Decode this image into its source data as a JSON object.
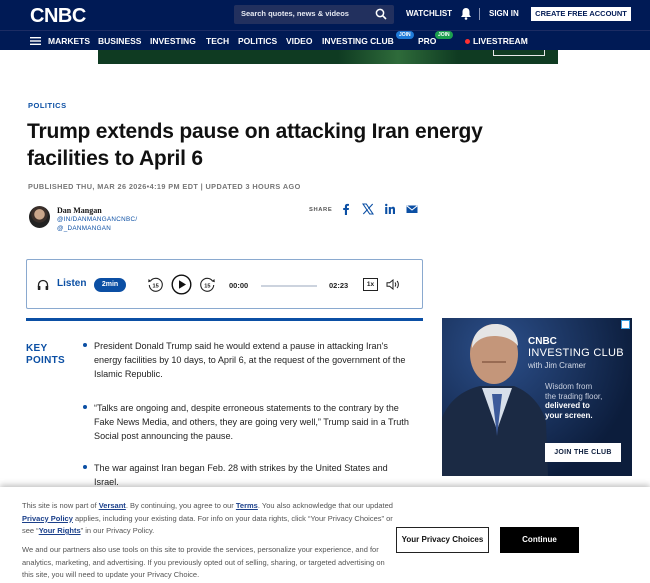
{
  "header": {
    "logo": "CNBC",
    "search_placeholder": "Search quotes, news & videos",
    "watchlist": "WATCHLIST",
    "sign_in": "SIGN IN",
    "create_account": "CREATE FREE ACCOUNT"
  },
  "nav": {
    "items": [
      "MARKETS",
      "BUSINESS",
      "INVESTING",
      "TECH",
      "POLITICS",
      "VIDEO",
      "INVESTING CLUB",
      "PRO",
      "LIVESTREAM"
    ],
    "badges": [
      "JOIN",
      "JOIN"
    ]
  },
  "article": {
    "category": "POLITICS",
    "headline": "Trump extends pause on attacking Iran energy facilities to April 6",
    "published": "PUBLISHED THU, MAR 26 2026•4:19 PM EDT | UPDATED 3 HOURS AGO",
    "author": {
      "name": "Dan Mangan",
      "handles": [
        "@IN/DANMANGANCNBC/",
        "@_DANMANGAN"
      ]
    },
    "share_label": "SHARE",
    "share_icons": [
      "facebook-icon",
      "x-icon",
      "linkedin-icon",
      "email-icon"
    ]
  },
  "player": {
    "listen_label": "Listen",
    "duration_badge": "2min",
    "rewind_label": "15",
    "forward_label": "15",
    "current_time": "00:00",
    "total_time": "02:23",
    "speed": "1x",
    "progress": 0
  },
  "key_points": {
    "label_line1": "KEY",
    "label_line2": "POINTS",
    "items": [
      "President Donald Trump said he would extend a pause in attacking Iran's energy facilities by 10 days, to April 6, at the request of the government of the Islamic Republic.",
      "“Talks are ongoing and, despite erroneous statements to the contrary by the Fake News Media, and others, they are going very well,” Trump said in a Truth Social post announcing the pause.",
      "The war against Iran began Feb. 28 with strikes by the United States and Israel."
    ]
  },
  "side_ad": {
    "logo": "CNBC",
    "title": "INVESTING CLUB",
    "subtitle": "with Jim Cramer",
    "tag_line1": "Wisdom from",
    "tag_line2": "the trading floor,",
    "tag_line3": "delivered to",
    "tag_line4": "your screen.",
    "cta": "JOIN THE CLUB"
  },
  "consent": {
    "p1_a": "This site is now part of ",
    "p1_link1": "Versant",
    "p1_b": ". By continuing, you agree to our ",
    "p1_link2": "Terms",
    "p1_c": ". You also acknowledge that our updated ",
    "p1_link3": "Privacy Policy",
    "p1_d": " applies, including your existing data. For info on your data rights, click “Your Privacy Choices” or see “",
    "p1_link4": "Your Rights",
    "p1_e": "” in our Privacy Policy.",
    "p2": "We and our partners also use tools on this site to provide the services, personalize your experience, and for analytics, marketing, and advertising. If you previously opted out of selling, sharing, or targeted advertising on this site, you will need to update your Privacy Choice.",
    "btn_privacy": "Your Privacy Choices",
    "btn_continue": "Continue"
  },
  "colors": {
    "header_bg": "#001a55",
    "accent_blue": "#0b4fa4"
  }
}
